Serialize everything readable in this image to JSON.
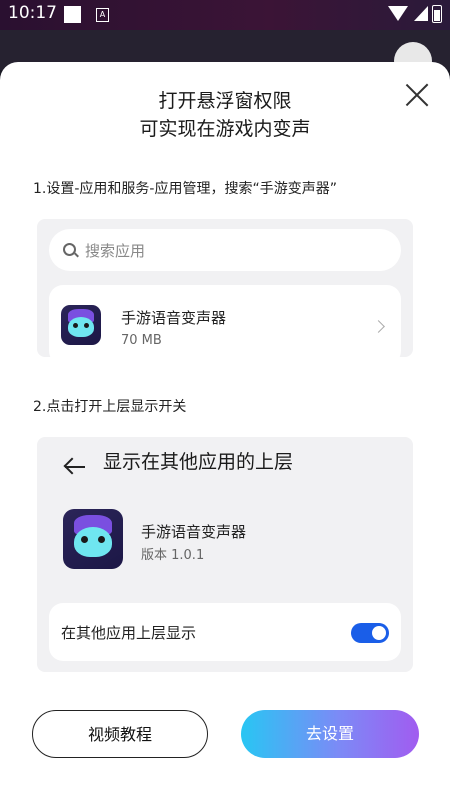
{
  "status_bar": {
    "time": "10:17",
    "notif_icon_glyph": "A"
  },
  "dialog": {
    "title_line1": "打开悬浮窗权限",
    "title_line2": "可实现在游戏内变声",
    "step1": "1.设置-应用和服务-应用管理，搜索“手游变声器”",
    "step2": "2.点击打开上层显示开关"
  },
  "card1": {
    "search_placeholder": "搜索应用",
    "app_name": "手游语音变声器",
    "app_size": "70 MB"
  },
  "card2": {
    "title": "显示在其他应用的上层",
    "app_name": "手游语音变声器",
    "version": "版本 1.0.1",
    "toggle_label": "在其他应用上层显示",
    "toggle_on": true
  },
  "buttons": {
    "video": "视频教程",
    "setup": "去设置"
  },
  "colors": {
    "accent": "#1a5ee8",
    "gradient_start": "#28c6f3",
    "gradient_end": "#a15cf0"
  }
}
